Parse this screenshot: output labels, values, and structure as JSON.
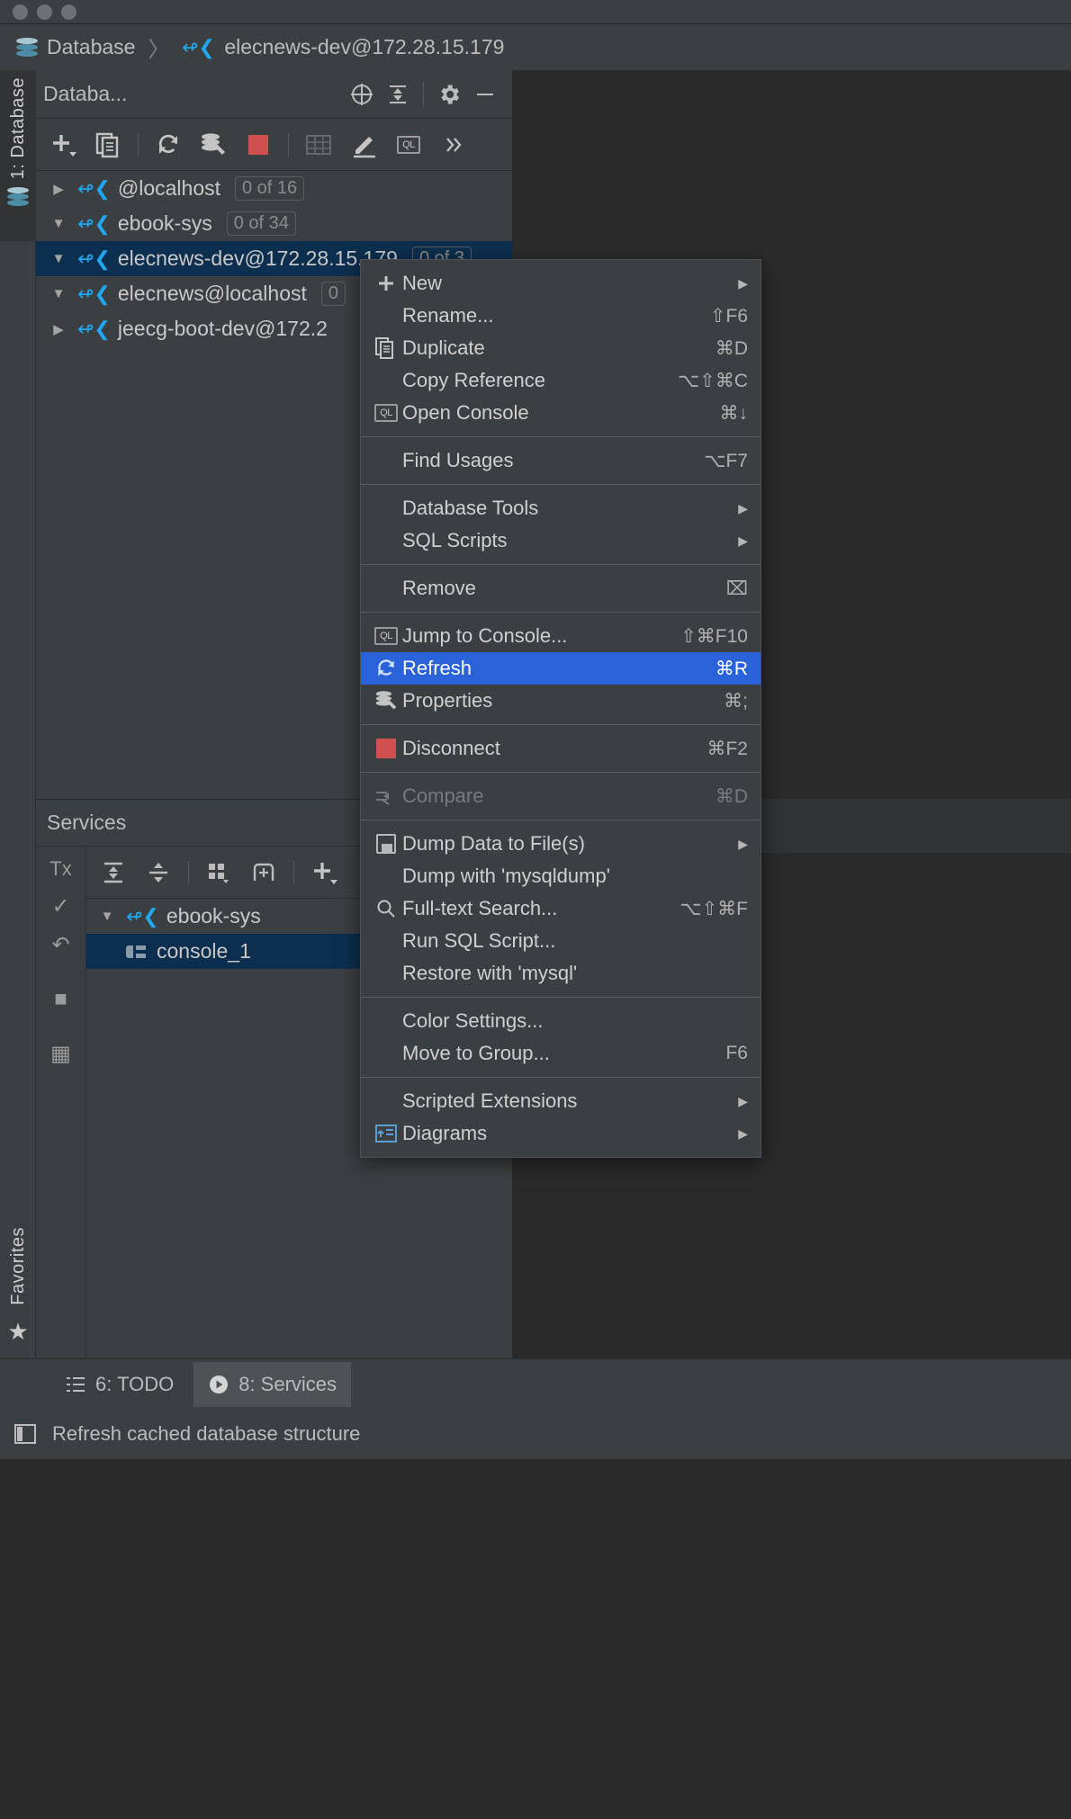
{
  "window": {
    "breadcrumb": {
      "root_label": "Database",
      "root_icon": "database-stack-icon",
      "separator": "〉",
      "leaf_label": "elecnews-dev@172.28.15.179",
      "leaf_icon": "mysql-dolphin-icon"
    }
  },
  "left_strip": {
    "database_label": "1: Database",
    "favorites_label": "Favorites",
    "favorites_icon": "star-icon",
    "database_icon": "database-stack-icon"
  },
  "database_panel": {
    "title": "Databa...",
    "header_buttons": [
      {
        "name": "locate-in-tree-icon",
        "glyph": "⊕"
      },
      {
        "name": "collapse-all-icon",
        "glyph": "⤓"
      },
      {
        "name": "settings-gear-icon",
        "glyph": "⚙"
      },
      {
        "name": "hide-window-icon",
        "glyph": "−"
      }
    ],
    "toolbar_buttons": [
      {
        "name": "add-data-source-icon",
        "label": "New"
      },
      {
        "name": "duplicate-icon",
        "label": "Duplicate"
      },
      {
        "name": "refresh-icon",
        "label": "Refresh"
      },
      {
        "name": "data-source-properties-icon",
        "label": "Properties"
      },
      {
        "name": "disconnect-icon",
        "label": "Disconnect"
      },
      {
        "name": "table-editor-icon",
        "label": "Open Table Editor"
      },
      {
        "name": "modify-icon",
        "label": "Modify"
      },
      {
        "name": "open-console-icon",
        "label": "Open Console"
      },
      {
        "name": "overflow-icon",
        "label": "»"
      }
    ],
    "tree": [
      {
        "expander": "collapsed",
        "icon": "mysql-dolphin-icon",
        "label": "@localhost",
        "count": "0 of 16",
        "selected": false
      },
      {
        "expander": "expanded",
        "icon": "mysql-dolphin-icon",
        "label": "ebook-sys",
        "count": "0 of 34",
        "selected": false
      },
      {
        "expander": "expanded",
        "icon": "mysql-dolphin-icon",
        "label": "elecnews-dev@172.28.15.179",
        "count": "0 of 3",
        "selected": true
      },
      {
        "expander": "expanded",
        "icon": "mysql-dolphin-icon",
        "label": "elecnews@localhost",
        "count": "0",
        "selected": false
      },
      {
        "expander": "collapsed",
        "icon": "mysql-dolphin-icon",
        "label": "jeecg-boot-dev@172.2",
        "count": "",
        "selected": false
      }
    ]
  },
  "services_panel": {
    "title": "Services",
    "side_buttons": [
      {
        "name": "tx-mode-icon",
        "label": "Tx"
      },
      {
        "name": "commit-icon",
        "label": "✓"
      },
      {
        "name": "rollback-icon",
        "label": "↶"
      },
      {
        "name": "stop-icon",
        "label": "■"
      },
      {
        "name": "layout-icon",
        "label": "▦"
      }
    ],
    "toolbar_buttons": [
      {
        "name": "expand-all-icon",
        "label": "Expand All"
      },
      {
        "name": "collapse-all-icon",
        "label": "Collapse All"
      },
      {
        "name": "group-by-icon",
        "label": "Group By"
      },
      {
        "name": "add-tab-icon",
        "label": "Add Tab"
      },
      {
        "name": "add-icon",
        "label": "Add"
      }
    ],
    "tree": [
      {
        "expander": "expanded",
        "icon": "mysql-dolphin-icon",
        "label": "ebook-sys",
        "selected": false
      },
      {
        "expander": "none",
        "icon": "console-icon",
        "label": "console_1",
        "selected": true
      }
    ]
  },
  "context_menu": {
    "items": [
      {
        "label": "New",
        "icon": "plus-icon",
        "shortcut": "",
        "submenu": true,
        "highlight": false,
        "disabled": false
      },
      {
        "label": "Rename...",
        "icon": "",
        "shortcut": "⇧F6",
        "submenu": false,
        "highlight": false,
        "disabled": false
      },
      {
        "label": "Duplicate",
        "icon": "duplicate-icon",
        "shortcut": "⌘D",
        "submenu": false,
        "highlight": false,
        "disabled": false
      },
      {
        "label": "Copy Reference",
        "icon": "",
        "shortcut": "⌥⇧⌘C",
        "submenu": false,
        "highlight": false,
        "disabled": false
      },
      {
        "label": "Open Console",
        "icon": "ql-console-icon",
        "shortcut": "⌘↓",
        "submenu": false,
        "highlight": false,
        "disabled": false
      },
      {
        "separator": true
      },
      {
        "label": "Find Usages",
        "icon": "",
        "shortcut": "⌥F7",
        "submenu": false,
        "highlight": false,
        "disabled": false
      },
      {
        "separator": true
      },
      {
        "label": "Database Tools",
        "icon": "",
        "shortcut": "",
        "submenu": true,
        "highlight": false,
        "disabled": false
      },
      {
        "label": "SQL Scripts",
        "icon": "",
        "shortcut": "",
        "submenu": true,
        "highlight": false,
        "disabled": false
      },
      {
        "separator": true
      },
      {
        "label": "Remove",
        "icon": "",
        "shortcut": "⌧",
        "submenu": false,
        "highlight": false,
        "disabled": false
      },
      {
        "separator": true
      },
      {
        "label": "Jump to Console...",
        "icon": "ql-console-icon",
        "shortcut": "⇧⌘F10",
        "submenu": false,
        "highlight": false,
        "disabled": false
      },
      {
        "label": "Refresh",
        "icon": "refresh-icon",
        "shortcut": "⌘R",
        "submenu": false,
        "highlight": true,
        "disabled": false
      },
      {
        "label": "Properties",
        "icon": "data-source-properties-icon",
        "shortcut": "⌘;",
        "submenu": false,
        "highlight": false,
        "disabled": false
      },
      {
        "separator": true
      },
      {
        "label": "Disconnect",
        "icon": "disconnect-icon",
        "shortcut": "⌘F2",
        "submenu": false,
        "highlight": false,
        "disabled": false
      },
      {
        "separator": true
      },
      {
        "label": "Compare",
        "icon": "compare-icon",
        "shortcut": "⌘D",
        "submenu": false,
        "highlight": false,
        "disabled": true
      },
      {
        "separator": true
      },
      {
        "label": "Dump Data to File(s)",
        "icon": "floppy-icon",
        "shortcut": "",
        "submenu": true,
        "highlight": false,
        "disabled": false
      },
      {
        "label": "Dump with 'mysqldump'",
        "icon": "",
        "shortcut": "",
        "submenu": false,
        "highlight": false,
        "disabled": false
      },
      {
        "label": "Full-text Search...",
        "icon": "search-icon",
        "shortcut": "⌥⇧⌘F",
        "submenu": false,
        "highlight": false,
        "disabled": false
      },
      {
        "label": "Run SQL Script...",
        "icon": "",
        "shortcut": "",
        "submenu": false,
        "highlight": false,
        "disabled": false
      },
      {
        "label": "Restore with 'mysql'",
        "icon": "",
        "shortcut": "",
        "submenu": false,
        "highlight": false,
        "disabled": false
      },
      {
        "separator": true
      },
      {
        "label": "Color Settings...",
        "icon": "",
        "shortcut": "",
        "submenu": false,
        "highlight": false,
        "disabled": false
      },
      {
        "label": "Move to Group...",
        "icon": "",
        "shortcut": "F6",
        "submenu": false,
        "highlight": false,
        "disabled": false
      },
      {
        "separator": true
      },
      {
        "label": "Scripted Extensions",
        "icon": "",
        "shortcut": "",
        "submenu": true,
        "highlight": false,
        "disabled": false
      },
      {
        "label": "Diagrams",
        "icon": "diagrams-icon",
        "shortcut": "",
        "submenu": true,
        "highlight": false,
        "disabled": false
      }
    ]
  },
  "bottom_tabs": [
    {
      "label": "6: TODO",
      "icon": "todo-list-icon",
      "active": false
    },
    {
      "label": "8: Services",
      "icon": "play-circle-icon",
      "active": true
    }
  ],
  "status_bar": {
    "icon": "layout-toggle-icon",
    "text": "Refresh cached database structure"
  },
  "colors": {
    "panel_bg": "#3c3f41",
    "editor_bg": "#2b2b2b",
    "selection_blue": "#0d2f4f",
    "highlight_blue": "#2962d9",
    "mysql_blue": "#21a6f0",
    "disconnect_red": "#d0504f",
    "text": "#cfcfcf"
  }
}
